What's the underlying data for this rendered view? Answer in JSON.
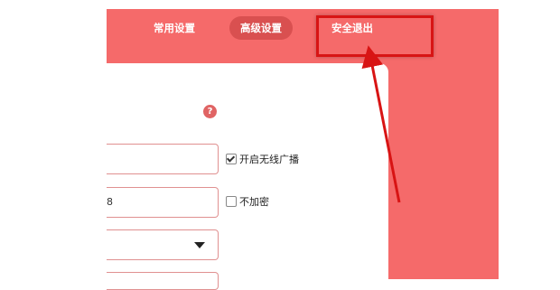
{
  "nav": {
    "common_settings": "常用设置",
    "advanced_settings": "高级设置",
    "safe_exit": "安全退出"
  },
  "help_icon": "?",
  "form": {
    "field2_value": "8",
    "broadcast_label": "开启无线广播",
    "broadcast_checked": true,
    "no_encrypt_label": "不加密",
    "no_encrypt_checked": false
  },
  "colors": {
    "brand": "#f56a6a",
    "annotation": "#d81414"
  }
}
